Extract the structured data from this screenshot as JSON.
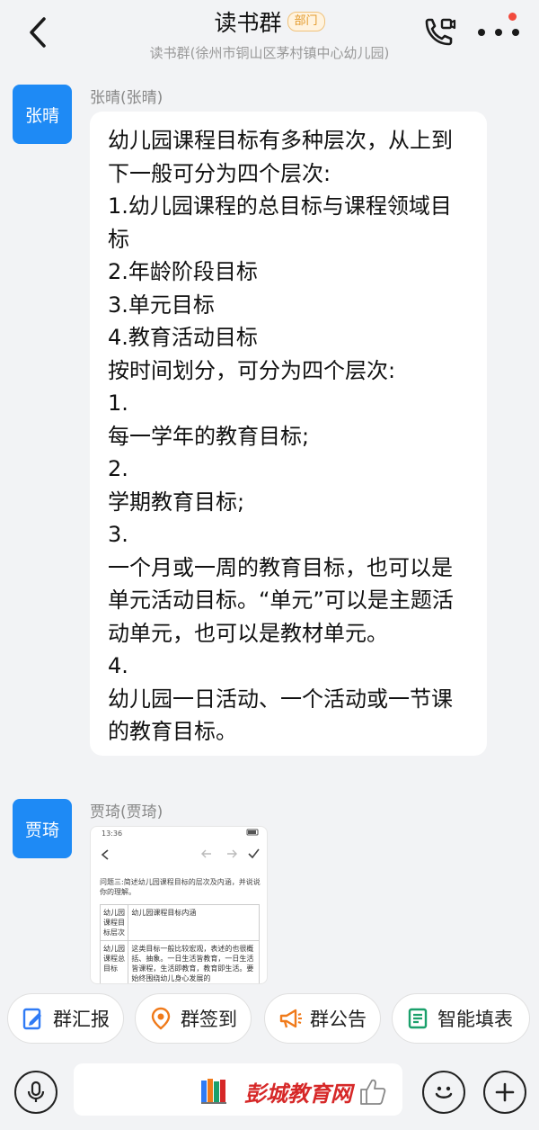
{
  "header": {
    "title": "读书群",
    "badge": "部门",
    "subtitle": "读书群(徐州市铜山区茅村镇中心幼儿园)",
    "icons": {
      "back": "back-chevron-icon",
      "call": "video-call-icon",
      "more": "more-dots-icon"
    },
    "notification_color": "#f24a3d"
  },
  "messages": [
    {
      "avatar_text": "张晴",
      "sender": "张晴(张晴)",
      "text": "幼儿园课程目标有多种层次，从上到下一般可分为四个层次:\n1.幼儿园课程的总目标与课程领域目标\n2.年龄阶段目标\n3.单元目标\n4.教育活动目标\n按时间划分，可分为四个层次:\n1.\n每一学年的教育目标;\n2.\n学期教育目标;\n3.\n一个月或一周的教育目标，也可以是单元活动目标。“单元”可以是主题活动单元，也可以是教材单元。\n4.\n幼儿园一日活动、一个活动或一节课的教育目标。"
    },
    {
      "avatar_text": "贾琦",
      "sender": "贾琦(贾琦)",
      "image": {
        "status_time": "13:36",
        "question": "问题三:简述幼儿园课程目标的层次及内涵，并说说你的理解。",
        "table_headers": [
          "幼儿园课程目标层次",
          "幼儿园课程目标内涵"
        ],
        "table_rows": [
          [
            "幼儿园课程总目标",
            "这类目标一般比较宏观，表述的也很概括、抽象。一日生活皆教育，一日生活皆课程，生活即教育，教育即生活。要始终围绕幼儿身心发展的"
          ]
        ]
      }
    }
  ],
  "quick_actions": [
    {
      "label": "群汇报",
      "icon": "report-icon",
      "color": "#2f7bf5"
    },
    {
      "label": "群签到",
      "icon": "location-pin-icon",
      "color": "#f07a1a"
    },
    {
      "label": "群公告",
      "icon": "megaphone-icon",
      "color": "#f07a1a"
    },
    {
      "label": "智能填表",
      "icon": "form-icon",
      "color": "#1aa06b"
    }
  ],
  "input_bar": {
    "voice_icon": "microphone-icon",
    "emoji_icon": "emoji-icon",
    "add_icon": "plus-icon",
    "watermark_text": "彭城教育网"
  }
}
